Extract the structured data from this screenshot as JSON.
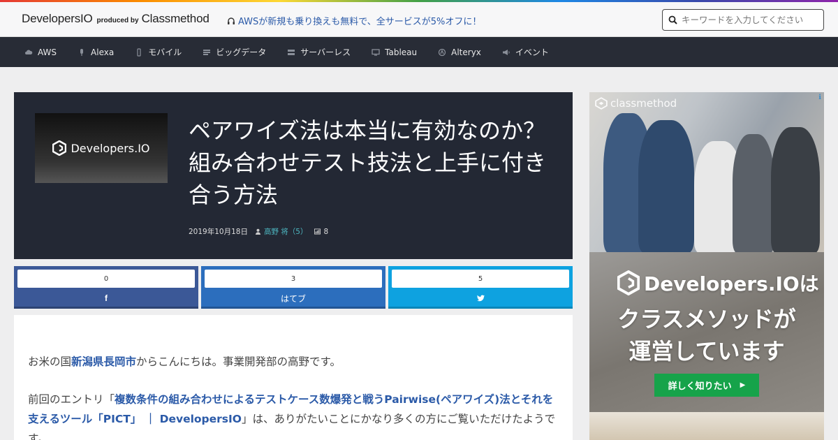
{
  "header": {
    "logo_main": "DevelopersIO",
    "logo_by": "produced by",
    "logo_company": "Classmethod",
    "promo_text": "AWSが新規も乗り換えも無料で、全サービスが5%オフに！",
    "search_placeholder": "キーワードを入力してください"
  },
  "nav": {
    "items": [
      {
        "label": "AWS",
        "icon": "cloud-icon"
      },
      {
        "label": "Alexa",
        "icon": "microphone-icon"
      },
      {
        "label": "モバイル",
        "icon": "mobile-icon"
      },
      {
        "label": "ビッグデータ",
        "icon": "data-icon"
      },
      {
        "label": "サーバーレス",
        "icon": "server-icon"
      },
      {
        "label": "Tableau",
        "icon": "monitor-icon"
      },
      {
        "label": "Alteryx",
        "icon": "alteryx-icon"
      },
      {
        "label": "イベント",
        "icon": "megaphone-icon"
      }
    ]
  },
  "article": {
    "thumb_label": "Developers.IO",
    "title": "ペアワイズ法は本当に有効なのか？組み合わせテスト技法と上手に付き合う方法",
    "date": "2019年10月18日",
    "author": "高野 将（5）",
    "views": "8",
    "para1_before": "お米の国",
    "para1_link": "新潟県長岡市",
    "para1_after": "からこんにちは。事業開発部の高野です。",
    "para2_before": "前回のエントリ「",
    "para2_link": "複数条件の組み合わせによるテストケース数爆発と戦うPairwise(ペアワイズ)法とそれを支えるツール「PICT」 ｜ DevelopersIO",
    "para2_after": "」は、ありがたいことにかなり多くの方にご覧いただけたようです。"
  },
  "shares": {
    "facebook": {
      "count": "0",
      "label": "f"
    },
    "hatena": {
      "count": "3",
      "label": "はてブ"
    },
    "twitter": {
      "count": "5",
      "label": "🐦"
    }
  },
  "ad": {
    "info": "ℹ",
    "cm_logo": "classmethod",
    "dev_brand": "Developers.IOは",
    "line1": "クラスメソッドが",
    "line2": "運営しています",
    "button": "詳しく知りたい",
    "button_arrow": "▶"
  },
  "colors": {
    "nav_bg": "#282c36",
    "hero_bg": "#232834",
    "link": "#2b5aa8",
    "facebook": "#3b5897",
    "hatena": "#2c6ebd",
    "twitter": "#0ea2e0",
    "ad_button": "#16a34a"
  }
}
